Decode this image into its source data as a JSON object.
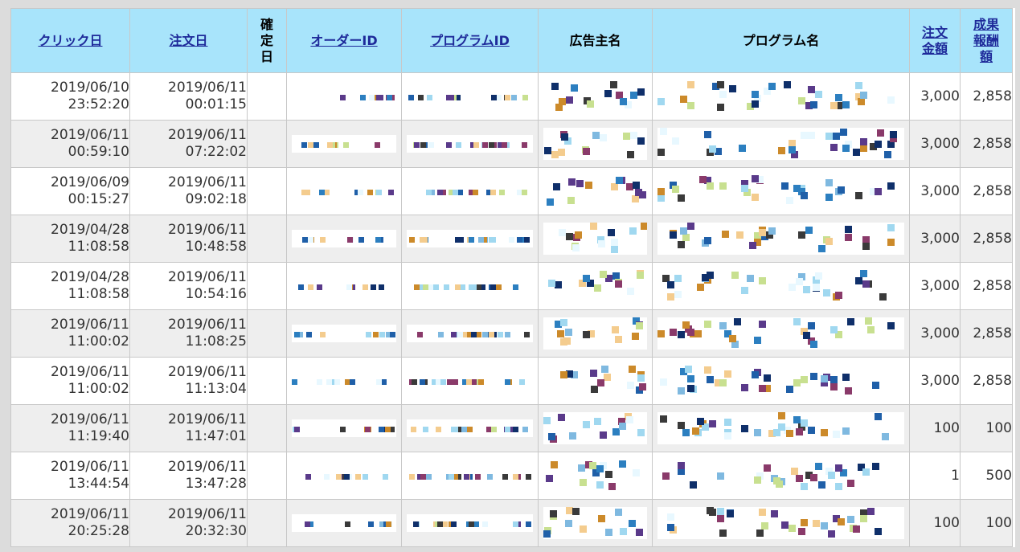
{
  "table": {
    "headers": {
      "click_date": "クリック日",
      "order_date": "注文日",
      "confirmed": "確\n定\n日",
      "order_id": "オーダーID",
      "program_id": "プログラムID",
      "advertiser": "広告主名",
      "program_name": "プログラム名",
      "order_amount": "注文\n金額",
      "reward": "成果\n報酬\n額"
    },
    "rows": [
      {
        "click_date": "2019/06/10",
        "click_time": "23:52:20",
        "order_date": "2019/06/11",
        "order_time": "00:01:15",
        "confirmed": "",
        "amount": "3,000",
        "reward": "2,858"
      },
      {
        "click_date": "2019/06/11",
        "click_time": "00:59:10",
        "order_date": "2019/06/11",
        "order_time": "07:22:02",
        "confirmed": "",
        "amount": "3,000",
        "reward": "2,858"
      },
      {
        "click_date": "2019/06/09",
        "click_time": "00:15:27",
        "order_date": "2019/06/11",
        "order_time": "09:02:18",
        "confirmed": "",
        "amount": "3,000",
        "reward": "2,858"
      },
      {
        "click_date": "2019/04/28",
        "click_time": "11:08:58",
        "order_date": "2019/06/11",
        "order_time": "10:48:58",
        "confirmed": "",
        "amount": "3,000",
        "reward": "2,858"
      },
      {
        "click_date": "2019/04/28",
        "click_time": "11:08:58",
        "order_date": "2019/06/11",
        "order_time": "10:54:16",
        "confirmed": "",
        "amount": "3,000",
        "reward": "2,858"
      },
      {
        "click_date": "2019/06/11",
        "click_time": "11:00:02",
        "order_date": "2019/06/11",
        "order_time": "11:08:25",
        "confirmed": "",
        "amount": "3,000",
        "reward": "2,858"
      },
      {
        "click_date": "2019/06/11",
        "click_time": "11:00:02",
        "order_date": "2019/06/11",
        "order_time": "11:13:04",
        "confirmed": "",
        "amount": "3,000",
        "reward": "2,858"
      },
      {
        "click_date": "2019/06/11",
        "click_time": "11:19:40",
        "order_date": "2019/06/11",
        "order_time": "11:47:01",
        "confirmed": "",
        "amount": "100",
        "reward": "100"
      },
      {
        "click_date": "2019/06/11",
        "click_time": "13:44:54",
        "order_date": "2019/06/11",
        "order_time": "13:47:28",
        "confirmed": "",
        "amount": "1",
        "reward": "500"
      },
      {
        "click_date": "2019/06/11",
        "click_time": "20:25:28",
        "order_date": "2019/06/11",
        "order_time": "20:32:30",
        "confirmed": "",
        "amount": "100",
        "reward": "100"
      }
    ]
  },
  "colors": {
    "header_bg": "#a8e4fb",
    "link": "#1e2a9a",
    "row_alt": "#eeeeee",
    "border": "#c8c8c8"
  },
  "pixelation_palette": [
    "#3a3a3a",
    "#a0d8f0",
    "#cc8a2a",
    "#7fb9e0",
    "#5a3a8a",
    "#1f5fa8",
    "#f4cc8e",
    "#c8e090",
    "#8a3a6a",
    "#0f2f6a",
    "#2c7fc0",
    "#e8f8ff"
  ]
}
